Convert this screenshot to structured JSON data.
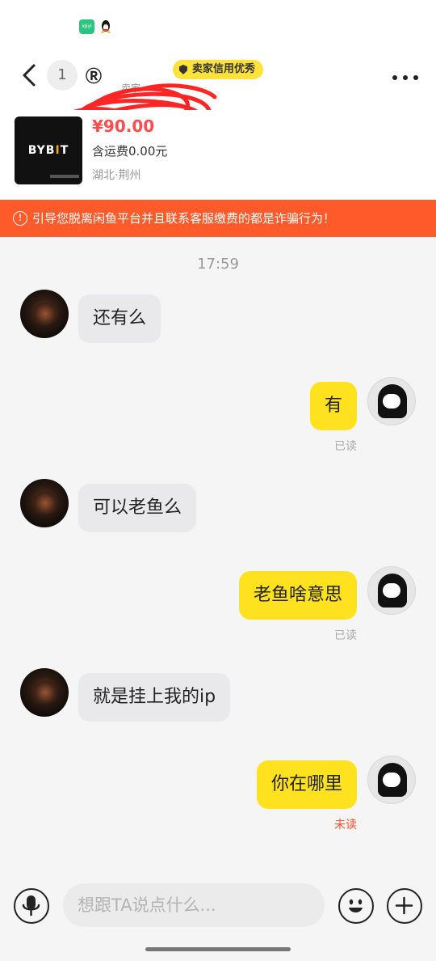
{
  "status_bar": {
    "app_icon_text": "iqiyi"
  },
  "header": {
    "peer_badge": "1",
    "peer_name": "Ⓡ",
    "peer_sub": "卖家",
    "credit_badge": "卖家信用优秀",
    "back_icon": "chevron-left-icon",
    "more_icon": "more-dots-icon"
  },
  "product": {
    "logo_prefix": "BYB",
    "logo_accent": "I",
    "logo_suffix": "T",
    "price": "¥90.00",
    "shipping": "含运费0.00元",
    "location": "湖北·荆州"
  },
  "warning": {
    "icon": "!",
    "text": "引导您脱离闲鱼平台并且联系客服缴费的都是诈骗行为！"
  },
  "chat": {
    "timestamp": "17:59",
    "messages": [
      {
        "side": "left",
        "text": "还有么"
      },
      {
        "side": "right",
        "text": "有",
        "status": "已读"
      },
      {
        "side": "left",
        "text": "可以老鱼么"
      },
      {
        "side": "right",
        "text": "老鱼啥意思",
        "status": "已读"
      },
      {
        "side": "left",
        "text": "就是挂上我的ip"
      },
      {
        "side": "right",
        "text": "你在哪里",
        "status": "未读"
      }
    ]
  },
  "input_bar": {
    "placeholder": "想跟TA说点什么...",
    "voice_icon": "microphone-icon",
    "emoji_icon": "emoji-icon",
    "plus_icon": "plus-icon"
  },
  "colors": {
    "accent_yellow": "#ffe21f",
    "warning_orange": "#ff5a2a",
    "price_red": "#ff4c4c",
    "unread_red": "#ff4c29"
  }
}
